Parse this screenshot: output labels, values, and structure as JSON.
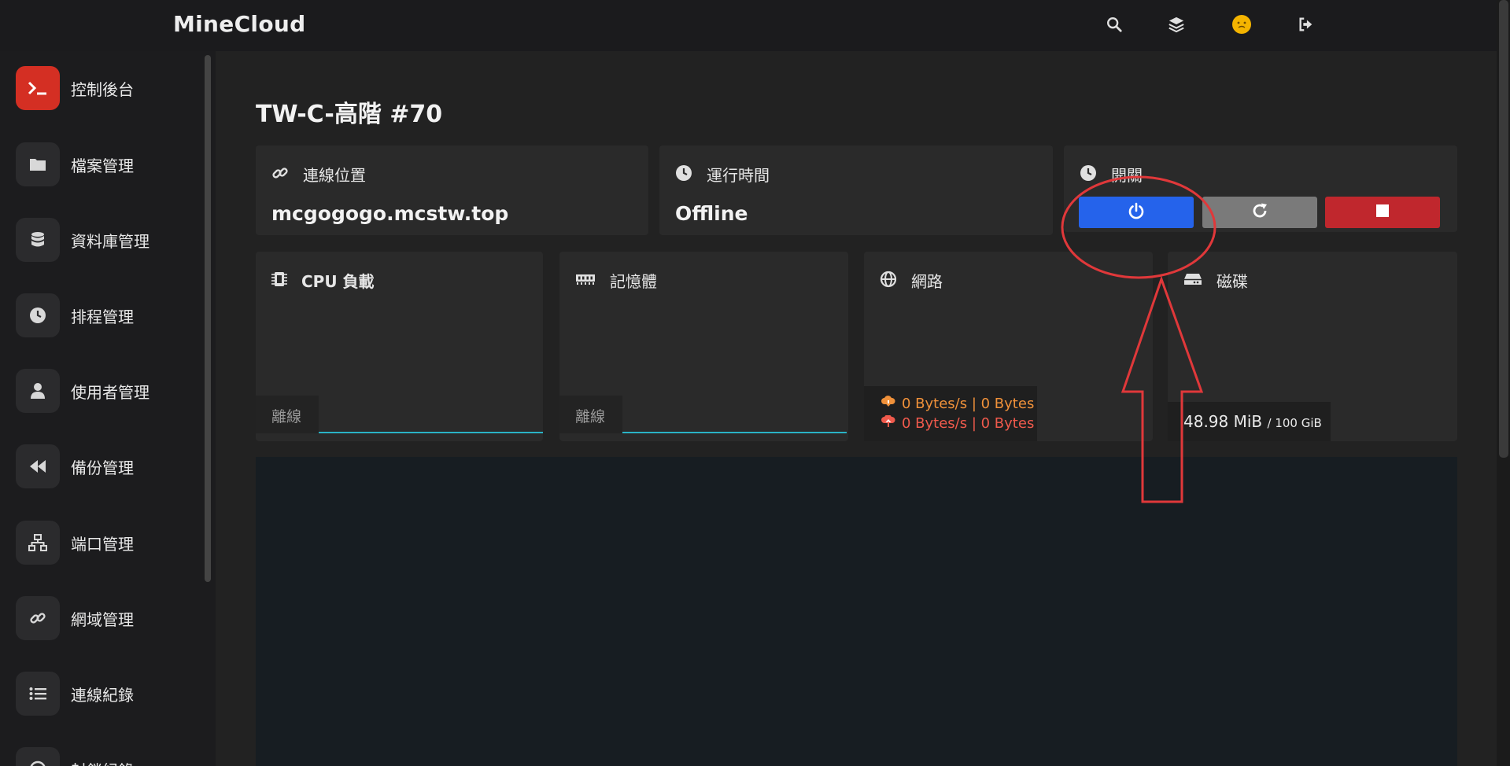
{
  "app": {
    "brand": "MineCloud"
  },
  "topbar": {
    "icons": [
      "search-icon",
      "layers-icon",
      "avatar",
      "logout-icon"
    ]
  },
  "sidebar": {
    "items": [
      {
        "label": "控制後台",
        "icon": "terminal-icon",
        "active": true
      },
      {
        "label": "檔案管理",
        "icon": "folder-icon"
      },
      {
        "label": "資料庫管理",
        "icon": "database-icon"
      },
      {
        "label": "排程管理",
        "icon": "clock-icon"
      },
      {
        "label": "使用者管理",
        "icon": "user-icon"
      },
      {
        "label": "備份管理",
        "icon": "rewind-icon"
      },
      {
        "label": "端口管理",
        "icon": "network-icon"
      },
      {
        "label": "網域管理",
        "icon": "link-icon"
      },
      {
        "label": "連線紀錄",
        "icon": "list-icon"
      },
      {
        "label": "封鎖紀錄",
        "icon": "ban-icon"
      }
    ]
  },
  "server": {
    "title": "TW-C-高階 #70",
    "address": {
      "label": "連線位置",
      "value": "mcgogogo.mcstw.top"
    },
    "uptime": {
      "label": "運行時間",
      "value": "Offline"
    },
    "power": {
      "label": "開關"
    }
  },
  "stats": {
    "cpu": {
      "label": "CPU 負載",
      "status": "離線"
    },
    "memory": {
      "label": "記憶體",
      "status": "離線"
    },
    "network": {
      "label": "網路",
      "download": "0 Bytes/s | 0 Bytes",
      "upload": "0 Bytes/s | 0 Bytes"
    },
    "disk": {
      "label": "磁碟",
      "used": "48.98 MiB",
      "total": "/ 100 GiB"
    }
  },
  "colors": {
    "accent_red": "#d42f23",
    "start_blue": "#2563eb",
    "restart_gray": "#7a7a7a",
    "stop_red": "#c0272d",
    "download_orange": "#f0913a",
    "upload_red": "#ef5a4c",
    "annotation": "#e0383a"
  }
}
